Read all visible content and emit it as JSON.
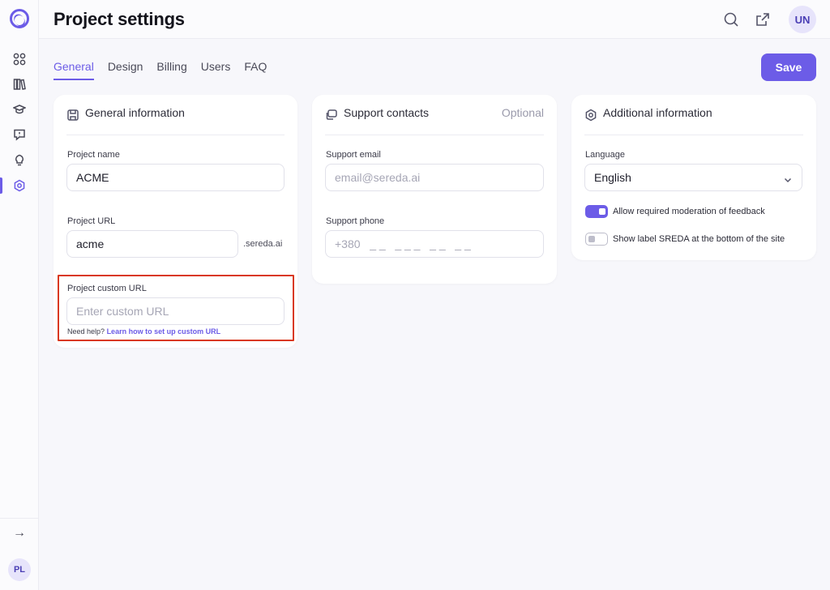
{
  "header": {
    "title": "Project settings",
    "user_initials": "UN"
  },
  "sidebar": {
    "items": [
      {
        "icon": "grid-icon"
      },
      {
        "icon": "library-icon"
      },
      {
        "icon": "graduation-cap-icon"
      },
      {
        "icon": "feedback-bubble-icon"
      },
      {
        "icon": "lightbulb-icon"
      },
      {
        "icon": "hexagon-settings-icon",
        "active": true
      }
    ],
    "user_initials": "PL"
  },
  "tabs": [
    {
      "label": "General",
      "active": true
    },
    {
      "label": "Design"
    },
    {
      "label": "Billing"
    },
    {
      "label": "Users"
    },
    {
      "label": "FAQ"
    }
  ],
  "save_label": "Save",
  "general": {
    "title": "General information",
    "project_name_label": "Project name",
    "project_name_value": "ACME",
    "project_url_label": "Project URL",
    "project_url_value": "acme",
    "project_url_suffix": ".sereda.ai",
    "custom_url_label": "Project custom URL",
    "custom_url_placeholder": "Enter custom URL",
    "help_text": "Need help?",
    "help_link": "Learn how to set up custom URL"
  },
  "support": {
    "title": "Support contacts",
    "optional": "Optional",
    "email_label": "Support email",
    "email_placeholder": "email@sereda.ai",
    "phone_label": "Support phone",
    "phone_placeholder": "+380   _ _   _ _ _   _ _   _ _"
  },
  "additional": {
    "title": "Additional information",
    "language_label": "Language",
    "language_value": "English",
    "toggle_moderation_label": "Allow required moderation of feedback",
    "toggle_moderation_on": true,
    "toggle_sreda_label": "Show label SREDA at the bottom of the site",
    "toggle_sreda_on": false
  },
  "colors": {
    "accent": "#6c5ce7",
    "highlight": "#d9381e"
  }
}
